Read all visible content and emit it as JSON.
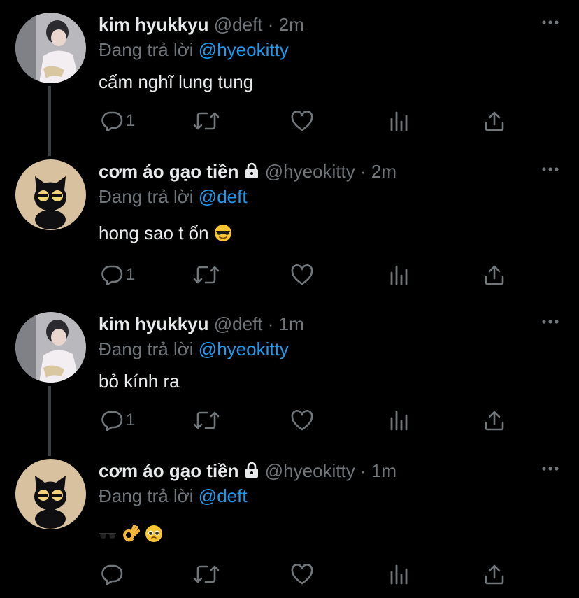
{
  "tweets": [
    {
      "name": "kim hyukkyu",
      "handle": "@deft",
      "time": "2m",
      "reply_prefix": "Đang trả lời",
      "reply_to": "@hyeokitty",
      "text": "cấm nghĩ lung tung",
      "reply_count": "1",
      "avatar": "person-reading-avatar",
      "locked": false
    },
    {
      "name": "cơm áo gạo tiền",
      "handle": "@hyeokitty",
      "time": "2m",
      "reply_prefix": "Đang trả lời",
      "reply_to": "@deft",
      "text": "hong sao t ổn",
      "emoji": [
        "sunglasses-face"
      ],
      "reply_count": "1",
      "avatar": "black-cat-avatar",
      "locked": true
    },
    {
      "name": "kim hyukkyu",
      "handle": "@deft",
      "time": "1m",
      "reply_prefix": "Đang trả lời",
      "reply_to": "@hyeokitty",
      "text": "bỏ kính ra",
      "reply_count": "1",
      "avatar": "person-reading-avatar",
      "locked": false
    },
    {
      "name": "cơm áo gạo tiền",
      "handle": "@hyeokitty",
      "time": "1m",
      "reply_prefix": "Đang trả lời",
      "reply_to": "@deft",
      "text": "",
      "emoji": [
        "dark-sunglasses",
        "ok-hand",
        "pleading-face"
      ],
      "reply_count": "",
      "avatar": "black-cat-avatar",
      "locked": true
    }
  ],
  "separator": "·",
  "colors": {
    "background": "#000000",
    "text": "#e7e9ea",
    "muted": "#71767b",
    "link": "#1d9bf0",
    "thread_line": "#3a3f44"
  },
  "icons": [
    "reply-icon",
    "retweet-icon",
    "like-icon",
    "analytics-icon",
    "share-icon",
    "more-icon",
    "lock-icon"
  ]
}
